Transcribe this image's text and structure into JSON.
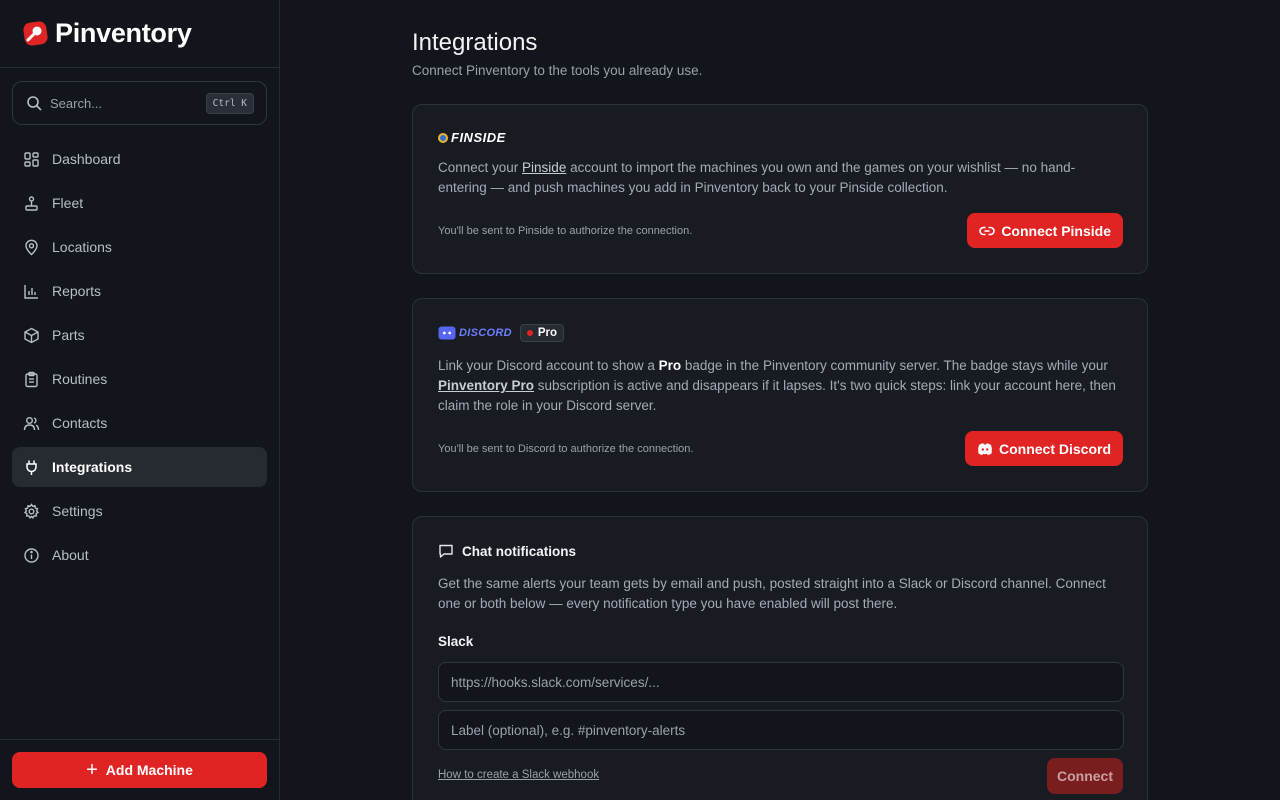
{
  "app": {
    "name": "Pinventory",
    "accent": "#e02424"
  },
  "search": {
    "placeholder": "Search...",
    "shortcut": "Ctrl K"
  },
  "sidebar": {
    "items": [
      {
        "label": "Dashboard",
        "icon": "dashboard-icon"
      },
      {
        "label": "Fleet",
        "icon": "joystick-icon"
      },
      {
        "label": "Locations",
        "icon": "map-pin-icon"
      },
      {
        "label": "Reports",
        "icon": "bar-chart-icon"
      },
      {
        "label": "Parts",
        "icon": "box-icon"
      },
      {
        "label": "Routines",
        "icon": "clipboard-icon"
      },
      {
        "label": "Contacts",
        "icon": "users-icon"
      },
      {
        "label": "Integrations",
        "icon": "plug-icon",
        "active": true
      },
      {
        "label": "Settings",
        "icon": "gear-icon"
      },
      {
        "label": "About",
        "icon": "info-icon"
      }
    ],
    "add_button": "Add Machine"
  },
  "page": {
    "title": "Integrations",
    "subtitle": "Connect Pinventory to the tools you already use."
  },
  "pinside": {
    "logo_text": "FINSIDE",
    "desc_pre": "Connect your ",
    "desc_link": "Pinside",
    "desc_post": " account to import the machines you own and the games on your wishlist — no hand-entering — and push machines you add in Pinventory back to your Pinside collection.",
    "note": "You'll be sent to Pinside to authorize the connection.",
    "button": "Connect Pinside"
  },
  "discord": {
    "logo_text": "DISCORD",
    "badge": "Pro",
    "desc_1": "Link your Discord account to show a ",
    "desc_bold": "Pro",
    "desc_2": " badge in the Pinventory community server. The badge stays while your ",
    "desc_link": "Pinventory Pro",
    "desc_3": " subscription is active and disappears if it lapses. It's two quick steps: link your account here, then claim the role in your Discord server.",
    "note": "You'll be sent to Discord to authorize the connection.",
    "button": "Connect Discord"
  },
  "chat": {
    "title": "Chat notifications",
    "desc": "Get the same alerts your team gets by email and push, posted straight into a Slack or Discord channel. Connect one or both below — every notification type you have enabled will post there.",
    "slack_label": "Slack",
    "webhook_placeholder": "https://hooks.slack.com/services/...",
    "label_placeholder": "Label (optional), e.g. #pinventory-alerts",
    "help_link": "How to create a Slack webhook",
    "connect_button": "Connect"
  }
}
